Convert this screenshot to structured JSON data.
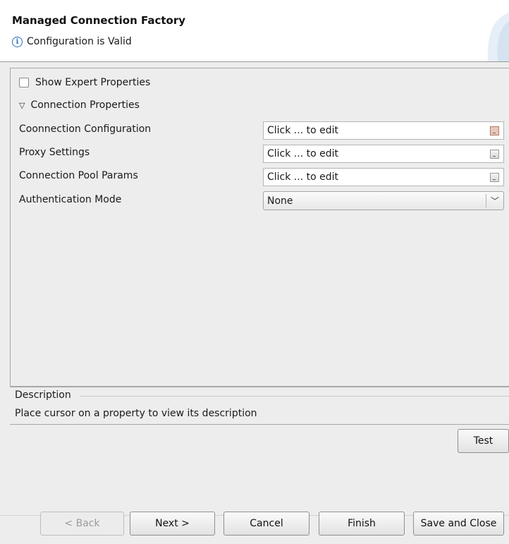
{
  "header": {
    "title": "Managed Connection Factory",
    "status": "Configuration is Valid",
    "status_icon": "info-icon"
  },
  "properties": {
    "show_expert_label": "Show Expert Properties",
    "show_expert_checked": false,
    "section_label": "Connection Properties",
    "section_icon": "triangle-down-icon",
    "rows": [
      {
        "label": "Coonnection Configuration",
        "value": "Click ... to edit"
      },
      {
        "label": "Proxy Settings",
        "value": "Click ... to edit"
      },
      {
        "label": "Connection Pool Params",
        "value": "Click ... to edit"
      }
    ],
    "auth": {
      "label": "Authentication Mode",
      "value": "None"
    }
  },
  "description": {
    "legend": "Description",
    "text": "Place cursor on a property to view its description"
  },
  "buttons": {
    "test": "Test",
    "back": "< Back",
    "next": "Next >",
    "cancel": "Cancel",
    "finish": "Finish",
    "save_close": "Save and Close"
  },
  "colors": {
    "background": "#ededed",
    "header_bg": "#ffffff",
    "info_blue": "#2b6bc3"
  }
}
